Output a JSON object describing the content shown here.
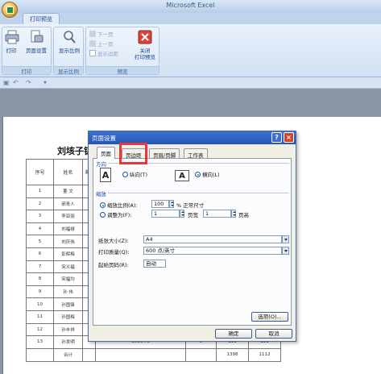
{
  "window": {
    "title": "Microsoft Excel"
  },
  "ribbon": {
    "active_tab": "打印预览",
    "groups": {
      "print": {
        "label": "打印",
        "buttons": [
          "打印",
          "页面设置"
        ]
      },
      "zoom": {
        "label": "显示比例",
        "buttons": [
          "显示比例"
        ]
      },
      "preview": {
        "label": "预览",
        "next_page": "下一页",
        "prev_page": "上一页",
        "show_margins": "显示边距",
        "close_line1": "关闭",
        "close_line2": "打印预览"
      }
    }
  },
  "sheet": {
    "title": "刘垓子镇",
    "header": {
      "no": "序号",
      "name": "姓名",
      "extra": "委员"
    },
    "rows": [
      {
        "no": "1",
        "name": "董 文"
      },
      {
        "no": "2",
        "name": "郝青人"
      },
      {
        "no": "3",
        "name": "李亚丽"
      },
      {
        "no": "4",
        "name": "刘福禄"
      },
      {
        "no": "5",
        "name": "刘庆伟"
      },
      {
        "no": "6",
        "name": "彭辉梅"
      },
      {
        "no": "7",
        "name": "宋义福"
      },
      {
        "no": "8",
        "name": "宋福均"
      },
      {
        "no": "9",
        "name": "孙 伟"
      },
      {
        "no": "10",
        "name": "孙国锋"
      },
      {
        "no": "11",
        "name": "孙国梅"
      },
      {
        "no": "12",
        "name": "孙丰祥"
      },
      {
        "no": "13",
        "name": "孙发明",
        "amount": "3666.76",
        "count": "5",
        "v1": "111",
        "v2": "111"
      }
    ],
    "total": {
      "label": "合计",
      "v1": "1398",
      "v2": "1112"
    }
  },
  "dialog": {
    "title": "页面设置",
    "help": "?",
    "tabs": [
      "页面",
      "页边距",
      "页眉/页脚",
      "工作表"
    ],
    "orientation": {
      "heading": "方向",
      "portrait": "纵向(T)",
      "landscape": "横向(L)",
      "selected": "landscape"
    },
    "scaling": {
      "heading": "缩放",
      "adjust_to": "缩放比例(A):",
      "adjust_value": "100",
      "adjust_suffix": "% 正常尺寸",
      "fit_to": "调整为(F):",
      "fit_wide": "1",
      "wide_label": "页宽",
      "fit_tall": "1",
      "tall_label": "页高",
      "selected": "adjust"
    },
    "paper_size": {
      "label": "纸张大小(Z):",
      "value": "A4"
    },
    "print_quality": {
      "label": "打印质量(Q):",
      "value": "600 点/英寸"
    },
    "first_page": {
      "label": "起始页码(R):",
      "value": "自动"
    },
    "options_button": "选项(O)...",
    "ok_button": "确定",
    "cancel_button": "取消"
  },
  "colors": {
    "highlight": "#e8383b",
    "title_bar": "#2457b8",
    "ribbon": "#d2e1f3"
  }
}
